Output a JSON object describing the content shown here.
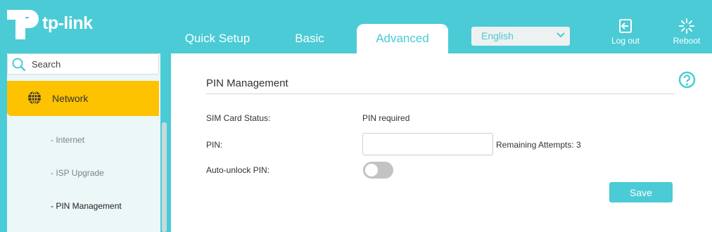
{
  "brand": {
    "name": "tp-link"
  },
  "nav": {
    "tabs": [
      {
        "label": "Quick Setup"
      },
      {
        "label": "Basic"
      },
      {
        "label": "Advanced",
        "active": true
      }
    ]
  },
  "language": {
    "selected": "English"
  },
  "header_actions": {
    "logout_label": "Log out",
    "reboot_label": "Reboot"
  },
  "sidebar": {
    "search_placeholder": "Search",
    "section": {
      "label": "Network"
    },
    "items": [
      {
        "label": "- Internet"
      },
      {
        "label": "- ISP Upgrade"
      },
      {
        "label": "- PIN Management",
        "active": true
      }
    ]
  },
  "main": {
    "section_title": "PIN Management",
    "sim_status": {
      "label": "SIM Card Status:",
      "value": "PIN required"
    },
    "pin": {
      "label": "PIN:",
      "value": "",
      "remaining": "Remaining Attempts: 3"
    },
    "auto_unlock": {
      "label": "Auto-unlock PIN:",
      "enabled": false
    },
    "save_label": "Save"
  },
  "colors": {
    "accent": "#4acbd6",
    "active_menu": "#fdc200",
    "sidebar_bg": "#ecf7f8",
    "toggle_off": "#c3c3c3"
  },
  "icons": [
    "tp-link-logo",
    "logout-icon",
    "reboot-icon",
    "search-icon",
    "globe-icon",
    "help-icon",
    "chevron-down-icon"
  ]
}
